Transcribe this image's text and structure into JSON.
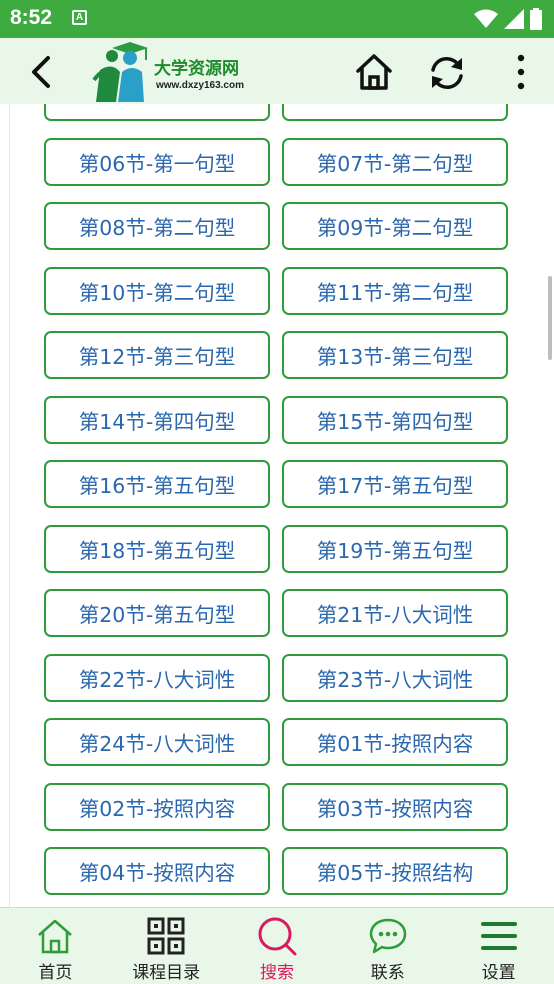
{
  "status_bar": {
    "time": "8:52",
    "notification_letter": "A"
  },
  "header": {
    "logo_title": "大学资源网",
    "logo_url": "www.dxzy163.com"
  },
  "lessons": [
    "第06节-第一句型",
    "第07节-第二句型",
    "第08节-第二句型",
    "第09节-第二句型",
    "第10节-第二句型",
    "第11节-第二句型",
    "第12节-第三句型",
    "第13节-第三句型",
    "第14节-第四句型",
    "第15节-第四句型",
    "第16节-第五句型",
    "第17节-第五句型",
    "第18节-第五句型",
    "第19节-第五句型",
    "第20节-第五句型",
    "第21节-八大词性",
    "第22节-八大词性",
    "第23节-八大词性",
    "第24节-八大词性",
    "第01节-按照内容",
    "第02节-按照内容",
    "第03节-按照内容",
    "第04节-按照内容",
    "第05节-按照结构"
  ],
  "bottom_nav": [
    {
      "label": "首页",
      "icon": "home-icon"
    },
    {
      "label": "课程目录",
      "icon": "grid-icon"
    },
    {
      "label": "搜索",
      "icon": "search-icon",
      "active": true
    },
    {
      "label": "联系",
      "icon": "chat-icon"
    },
    {
      "label": "设置",
      "icon": "menu-icon"
    }
  ],
  "colors": {
    "status_bar": "#3dab3f",
    "header_bg": "#e9f7e8",
    "button_border": "#2e9c3a",
    "button_text": "#2a67ad",
    "active_nav": "#d81b60"
  }
}
